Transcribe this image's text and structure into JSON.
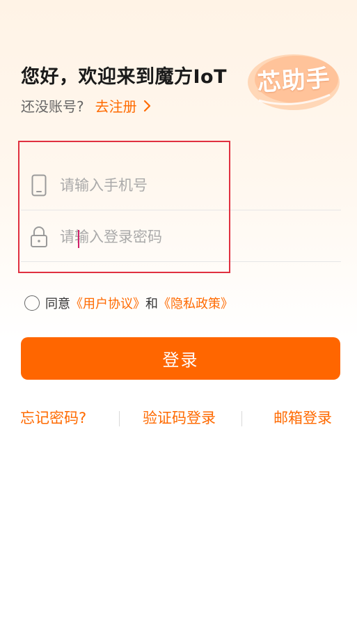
{
  "header": {
    "greeting": "您好，欢迎来到魔方IoT",
    "no_account_text": "还没账号?",
    "register_link": "去注册",
    "badge_text": "芯助手"
  },
  "form": {
    "phone_placeholder": "请输入手机号",
    "password_placeholder": "请输入登录密码",
    "phone_value": "",
    "password_value": ""
  },
  "agreement": {
    "prefix": "同意",
    "user_agreement": "《用户协议》",
    "and": "和",
    "privacy_policy": "《隐私政策》",
    "checked": false
  },
  "login_button": "登录",
  "bottom_links": {
    "forgot_password": "忘记密码?",
    "code_login": "验证码登录",
    "email_login": "邮箱登录"
  },
  "colors": {
    "accent": "#ff6600",
    "highlight_border": "#e03040"
  },
  "icons": {
    "phone": "phone-icon",
    "lock": "lock-icon",
    "register_chevron": "chevron-right-icon"
  }
}
